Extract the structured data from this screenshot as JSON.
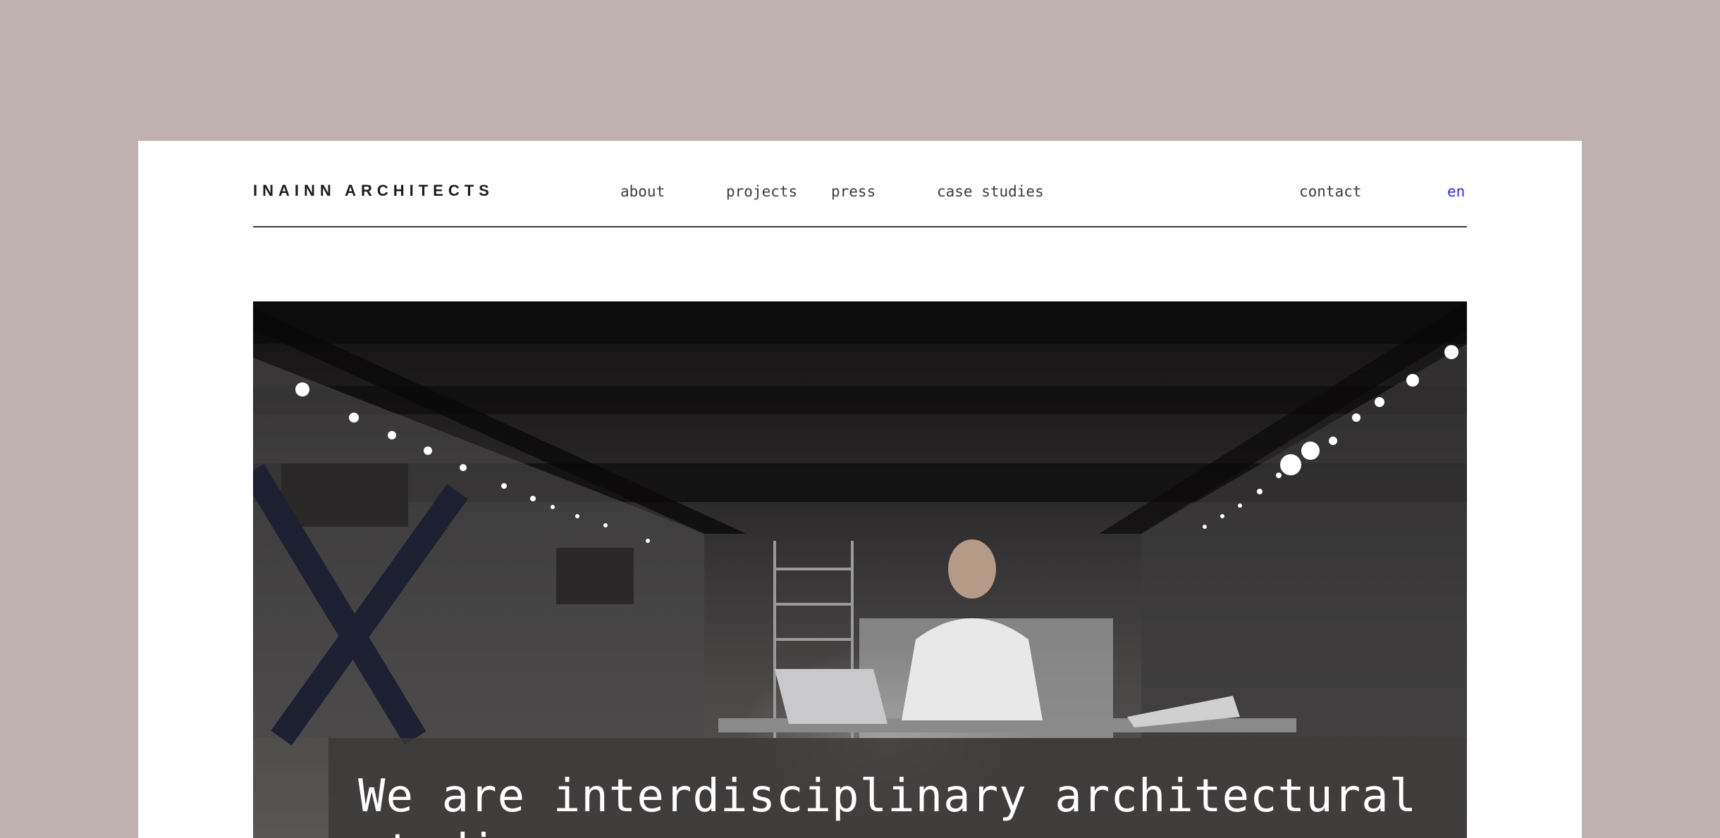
{
  "brand": {
    "logo_text": "INAINN ARCHITECTS"
  },
  "nav": {
    "about": "about",
    "projects": "projects",
    "press": "press",
    "case_studies": "case studies",
    "contact": "contact",
    "language": "en"
  },
  "hero": {
    "caption": "We are interdisciplinary architectural studio"
  },
  "colors": {
    "background": "#bfb0b0",
    "page": "#ffffff",
    "language_accent": "#2a2ae0",
    "text": "#3c3c3c"
  }
}
